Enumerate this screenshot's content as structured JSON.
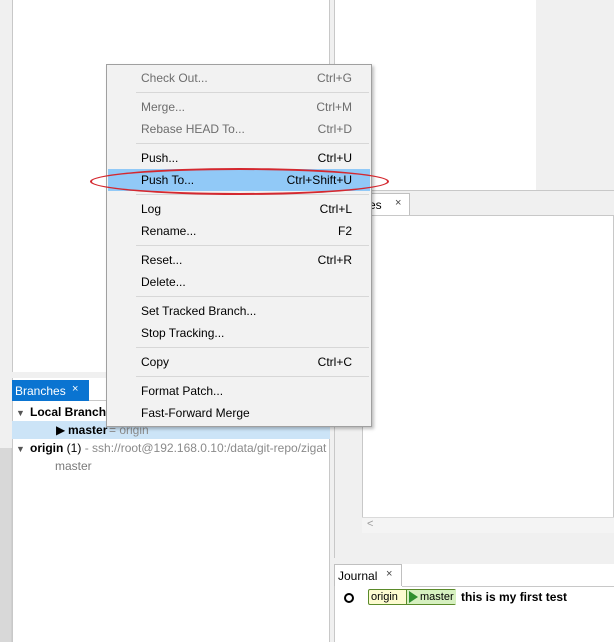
{
  "branches_tab": {
    "label": "Branches",
    "close": "×"
  },
  "changes_tab": {
    "label": "es",
    "close": "×"
  },
  "journal_tab": {
    "label": "Journal",
    "close": "×"
  },
  "tree": {
    "local_label": "Local Branch",
    "master_name": "master",
    "master_tracking": "= origin",
    "origin_name": "origin",
    "origin_count": "(1)",
    "origin_url": "- ssh://root@192.168.0.10:/data/git-repo/zigat",
    "remote_master": "master"
  },
  "journal": {
    "ref_origin": "origin",
    "ref_master": "master",
    "message": "this is my first test"
  },
  "context_menu": {
    "checkout": {
      "label": "Check Out...",
      "shortcut": "Ctrl+G"
    },
    "merge": {
      "label": "Merge...",
      "shortcut": "Ctrl+M"
    },
    "rebase": {
      "label": "Rebase HEAD To...",
      "shortcut": "Ctrl+D"
    },
    "push": {
      "label": "Push...",
      "shortcut": "Ctrl+U"
    },
    "push_to": {
      "label": "Push To...",
      "shortcut": "Ctrl+Shift+U"
    },
    "log": {
      "label": "Log",
      "shortcut": "Ctrl+L"
    },
    "rename": {
      "label": "Rename...",
      "shortcut": "F2"
    },
    "reset": {
      "label": "Reset...",
      "shortcut": "Ctrl+R"
    },
    "delete": {
      "label": "Delete...",
      "shortcut": ""
    },
    "set_tracked": {
      "label": "Set Tracked Branch...",
      "shortcut": ""
    },
    "stop_tracking": {
      "label": "Stop Tracking...",
      "shortcut": ""
    },
    "copy": {
      "label": "Copy",
      "shortcut": "Ctrl+C"
    },
    "format_patch": {
      "label": "Format Patch...",
      "shortcut": ""
    },
    "fast_forward": {
      "label": "Fast-Forward Merge",
      "shortcut": ""
    }
  },
  "colors": {
    "accent_tab": "#0a74d1",
    "selection": "#cce4f7",
    "menu_highlight": "#91c9f7",
    "annotation_oval": "#d4282f"
  }
}
